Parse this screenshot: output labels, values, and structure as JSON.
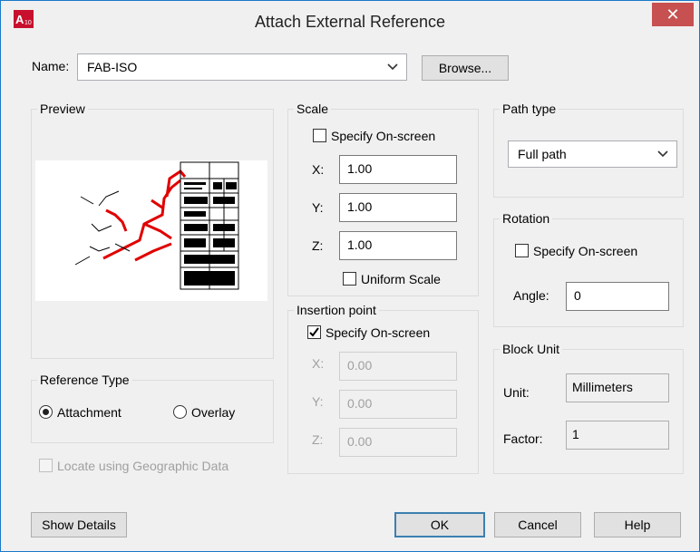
{
  "window": {
    "title": "Attach External Reference",
    "close_symbol": "✕"
  },
  "name_field": {
    "label": "Name:",
    "value": "FAB-ISO",
    "browse_label": "Browse..."
  },
  "preview": {
    "title": "Preview"
  },
  "reference_type": {
    "title": "Reference Type",
    "attachment_label": "Attachment",
    "overlay_label": "Overlay",
    "selected": "Attachment"
  },
  "locate_geo": {
    "label": "Locate using Geographic Data",
    "checked": false
  },
  "scale": {
    "title": "Scale",
    "specify_label": "Specify On-screen",
    "specify_checked": false,
    "x_label": "X:",
    "x_value": "1.00",
    "y_label": "Y:",
    "y_value": "1.00",
    "z_label": "Z:",
    "z_value": "1.00",
    "uniform_label": "Uniform Scale",
    "uniform_checked": false
  },
  "insertion_point": {
    "title": "Insertion point",
    "specify_label": "Specify On-screen",
    "specify_checked": true,
    "x_label": "X:",
    "x_value": "0.00",
    "y_label": "Y:",
    "y_value": "0.00",
    "z_label": "Z:",
    "z_value": "0.00"
  },
  "path_type": {
    "title": "Path type",
    "value": "Full path"
  },
  "rotation": {
    "title": "Rotation",
    "specify_label": "Specify On-screen",
    "specify_checked": false,
    "angle_label": "Angle:",
    "angle_value": "0"
  },
  "block_unit": {
    "title": "Block Unit",
    "unit_label": "Unit:",
    "unit_value": "Millimeters",
    "factor_label": "Factor:",
    "factor_value": "1"
  },
  "buttons": {
    "show_details": "Show Details",
    "ok": "OK",
    "cancel": "Cancel",
    "help": "Help"
  },
  "colors": {
    "accent": "#1979ca",
    "close_bg": "#c75050",
    "preview_drawing": "#e00000"
  }
}
